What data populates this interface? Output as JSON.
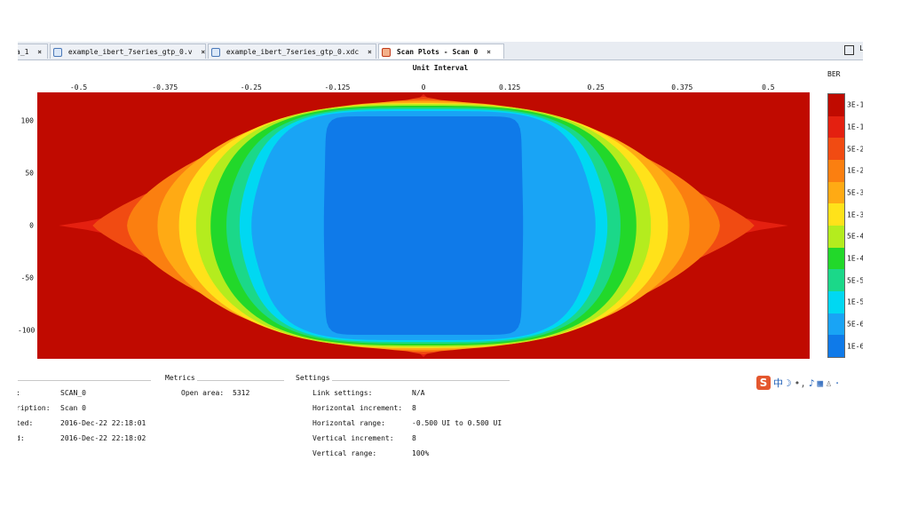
{
  "tabs": [
    {
      "label": "a_1",
      "close": "×"
    },
    {
      "label": "example_ibert_7series_gtp_0.v",
      "close": "×"
    },
    {
      "label": "example_ibert_7series_gtp_0.xdc",
      "close": "×"
    },
    {
      "label": "Scan Plots - Scan 0",
      "close": "×",
      "active": true
    }
  ],
  "tab_right_label": "L",
  "plot": {
    "title": "Unit Interval",
    "legend_title": "BER",
    "x_ticks": [
      "-0.5",
      "-0.375",
      "-0.25",
      "-0.125",
      "0",
      "0.125",
      "0.25",
      "0.375",
      "0.5"
    ],
    "y_ticks": [
      "100",
      "50",
      "0",
      "-50",
      "-100"
    ],
    "legend_labels": [
      "3E-1",
      "1E-1",
      "5E-2",
      "1E-2",
      "5E-3",
      "1E-3",
      "5E-4",
      "1E-4",
      "5E-5",
      "1E-5",
      "5E-6",
      "1E-6"
    ]
  },
  "colors": {
    "levels": [
      "#c00a00",
      "#e42010",
      "#f14b12",
      "#fb7f10",
      "#ffaa14",
      "#ffe21a",
      "#b4ec1e",
      "#22d82a",
      "#1bd889",
      "#00d8f2",
      "#19a4f5",
      "#0f7ae9"
    ]
  },
  "chart_data": {
    "type": "heatmap",
    "title": "Unit Interval",
    "xlabel": "",
    "ylabel": "",
    "xlim": [
      -0.56,
      0.56
    ],
    "ylim": [
      -127,
      127
    ],
    "legend": "BER",
    "open_area": 5312
  },
  "info": {
    "left_rows": [
      {
        "label": ":",
        "value": "SCAN_0"
      },
      {
        "label": "ription:",
        "value": "Scan 0"
      },
      {
        "label": "ted:",
        "value": "2016-Dec-22 22:18:01"
      },
      {
        "label": "d:",
        "value": "2016-Dec-22 22:18:02"
      }
    ],
    "metrics_title": "Metrics",
    "metrics_label": "Open area:",
    "metrics_value": "5312",
    "settings_title": "Settings",
    "settings_rows": [
      {
        "label": "Link settings:",
        "value": "N/A"
      },
      {
        "label": "Horizontal increment:",
        "value": "8"
      },
      {
        "label": "Horizontal range:",
        "value": "-0.500 UI to 0.500 UI"
      },
      {
        "label": "Vertical increment:",
        "value": "8"
      },
      {
        "label": "Vertical range:",
        "value": "100%"
      }
    ]
  },
  "tray": {
    "ime_logo": "S",
    "ime_lang": "中"
  }
}
